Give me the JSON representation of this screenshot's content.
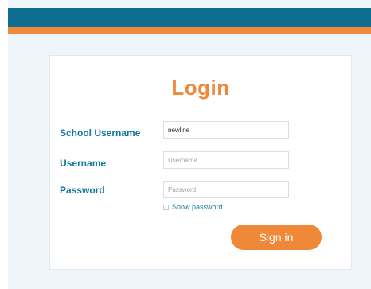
{
  "colors": {
    "header": "#0f6e8f",
    "accent": "#f0883a",
    "label": "#157a99",
    "background": "#eef6fc"
  },
  "login": {
    "title": "Login",
    "school_username_label": "School Username",
    "school_username_value": "newline",
    "username_label": "Username",
    "username_placeholder": "Username",
    "password_label": "Password",
    "password_placeholder": "Password",
    "show_password_label": "Show password",
    "show_password_checked": false,
    "signin_label": "Sign in"
  }
}
